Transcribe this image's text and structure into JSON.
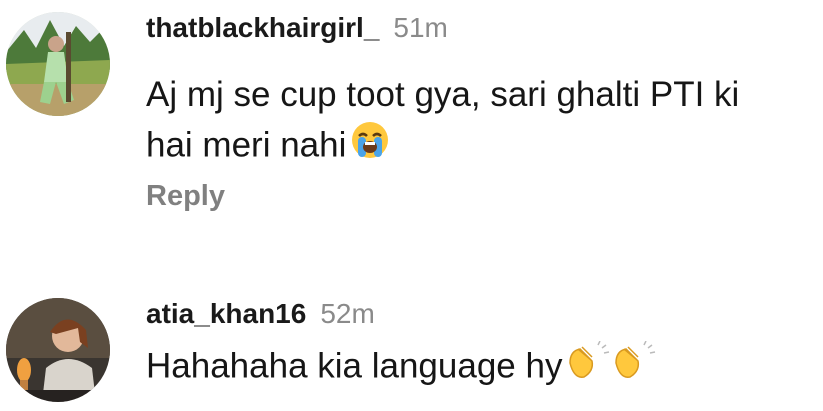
{
  "comments": [
    {
      "username": "thatblackhairgirl_",
      "time": "51m",
      "text_line1": "Aj mj se cup toot gya, sari ghalti PTI ki",
      "text_line2": "hai meri nahi",
      "emoji": "loudly-crying-face",
      "reply_label": "Reply"
    },
    {
      "username": "atia_khan16",
      "time": "52m",
      "text_line1": "Hahahaha kia language hy",
      "emoji": "clapping-hands"
    }
  ],
  "colors": {
    "username": "#1a1a1a",
    "time": "#8a8a8a",
    "body": "#161616",
    "reply": "#808080",
    "emoji_yellow": "#ffc83d"
  }
}
